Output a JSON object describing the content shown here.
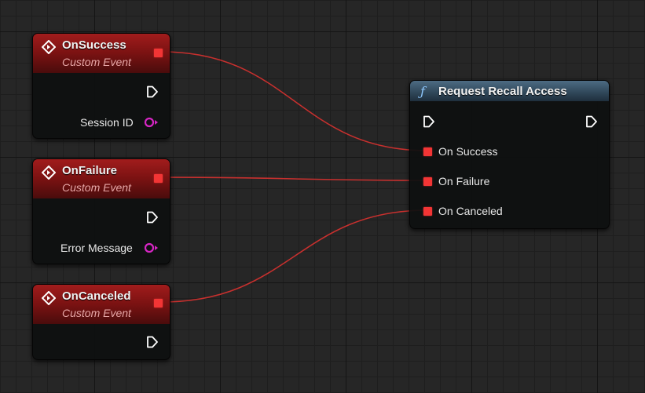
{
  "event_nodes": [
    {
      "title": "OnSuccess",
      "subtitle": "Custom Event",
      "output_label": "Session ID"
    },
    {
      "title": "OnFailure",
      "subtitle": "Custom Event",
      "output_label": "Error Message"
    },
    {
      "title": "OnCanceled",
      "subtitle": "Custom Event"
    }
  ],
  "function_node": {
    "title": "Request Recall Access",
    "inputs": [
      {
        "label": "On Success"
      },
      {
        "label": "On Failure"
      },
      {
        "label": "On Canceled"
      }
    ]
  },
  "colors": {
    "delegate_pin": "#f23535",
    "wire": "#d63030",
    "string_pin": "#d726c5",
    "event_header": "#8a1515",
    "function_header": "#3a566c"
  },
  "icons": {
    "event": "event-icon",
    "function": "function-icon",
    "exec": "exec-pin-icon"
  }
}
